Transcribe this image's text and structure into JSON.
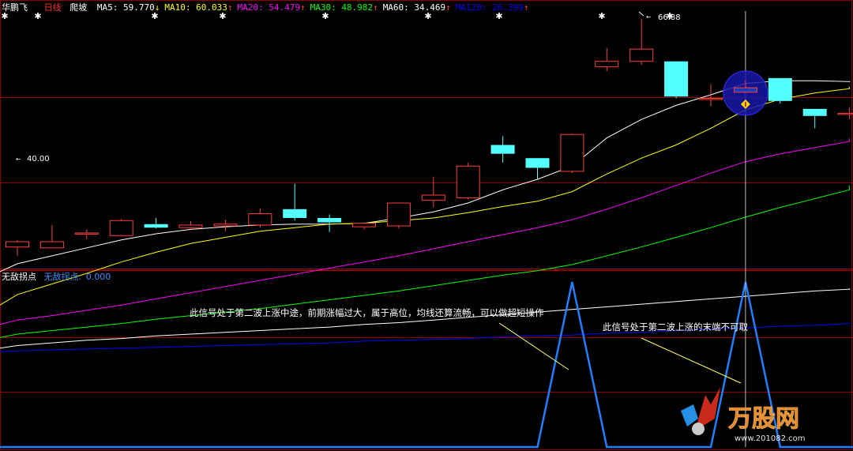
{
  "header": {
    "stock_name": "华鹏飞",
    "period": "日线",
    "pattern": "爬坡",
    "ma": [
      {
        "label": "MA5:",
        "value": "59.770",
        "arrow": "↓",
        "color": "#ffffff"
      },
      {
        "label": "MA10:",
        "value": "60.033",
        "arrow": "↑",
        "color": "#ffff00"
      },
      {
        "label": "MA20:",
        "value": "54.479",
        "arrow": "↑",
        "color": "#ff00ff"
      },
      {
        "label": "MA30:",
        "value": "48.982",
        "arrow": "↑",
        "color": "#00ff00"
      },
      {
        "label": "MA60:",
        "value": "34.469",
        "arrow": "↑",
        "color": "#ffffff"
      },
      {
        "label": "MA120:",
        "value": "26.399",
        "arrow": "↑",
        "color": "#0000ff"
      }
    ]
  },
  "indicator_header": {
    "name": "无敌拐点",
    "series_label": "无敌拐点:",
    "series_value": "0.000"
  },
  "annotations": {
    "high_price": "66.88",
    "low_price": "40.00",
    "note1": "此信号处于第二波上涨中途，前期涨幅过大，属于高位，均线还算流畅，可以做超短操作",
    "note2": "此信号处于第二波上涨的末端不可取"
  },
  "watermark": {
    "brand": "万股网",
    "url": "www.201082.com"
  },
  "colors": {
    "up": "#ff3d3d",
    "down": "#54ffff",
    "grid": "#8b0000",
    "signal": "#1e7fff",
    "name": "#ff3030"
  },
  "chart_data": {
    "type": "candlestick",
    "ylim": [
      39,
      68
    ],
    "candles": [
      {
        "o": 41.0,
        "h": 41.8,
        "l": 40.0,
        "c": 41.6
      },
      {
        "o": 40.9,
        "h": 43.5,
        "l": 40.9,
        "c": 41.6
      },
      {
        "o": 42.6,
        "h": 43.0,
        "l": 41.9,
        "c": 42.6
      },
      {
        "o": 42.3,
        "h": 44.2,
        "l": 42.2,
        "c": 44.0
      },
      {
        "o": 43.6,
        "h": 44.3,
        "l": 43.1,
        "c": 43.2
      },
      {
        "o": 43.2,
        "h": 43.9,
        "l": 43.0,
        "c": 43.5
      },
      {
        "o": 43.4,
        "h": 44.1,
        "l": 42.8,
        "c": 43.6
      },
      {
        "o": 43.5,
        "h": 45.4,
        "l": 43.2,
        "c": 44.8
      },
      {
        "o": 45.3,
        "h": 48.2,
        "l": 44.0,
        "c": 44.3
      },
      {
        "o": 44.3,
        "h": 44.7,
        "l": 42.7,
        "c": 43.8
      },
      {
        "o": 43.3,
        "h": 43.8,
        "l": 43.0,
        "c": 43.7
      },
      {
        "o": 43.4,
        "h": 46.0,
        "l": 43.1,
        "c": 46.0
      },
      {
        "o": 46.3,
        "h": 49.0,
        "l": 45.5,
        "c": 46.9
      },
      {
        "o": 46.6,
        "h": 50.6,
        "l": 46.4,
        "c": 50.2
      },
      {
        "o": 52.6,
        "h": 53.6,
        "l": 50.6,
        "c": 51.6
      },
      {
        "o": 51.1,
        "h": 51.1,
        "l": 48.7,
        "c": 50.0
      },
      {
        "o": 49.6,
        "h": 53.9,
        "l": 49.4,
        "c": 53.8
      },
      {
        "o": 61.5,
        "h": 63.6,
        "l": 61.0,
        "c": 62.1
      },
      {
        "o": 62.1,
        "h": 66.9,
        "l": 61.7,
        "c": 63.5
      },
      {
        "o": 62.1,
        "h": 62.1,
        "l": 57.9,
        "c": 58.1
      },
      {
        "o": 57.9,
        "h": 59.5,
        "l": 57.0,
        "c": 57.9
      },
      {
        "o": 59.1,
        "h": 59.9,
        "l": 56.5,
        "c": 58.6
      },
      {
        "o": 60.2,
        "h": 60.2,
        "l": 57.3,
        "c": 57.6
      },
      {
        "o": 56.7,
        "h": 56.7,
        "l": 54.5,
        "c": 55.9
      },
      {
        "o": 56.2,
        "h": 56.9,
        "l": 55.5,
        "c": 56.2
      }
    ],
    "ma_series": [
      {
        "name": "MA5",
        "color": "#ffffff",
        "values": [
          [
            0,
            39.1
          ],
          [
            1,
            40.0
          ],
          [
            2,
            40.9
          ],
          [
            3,
            41.8
          ],
          [
            4,
            42.5
          ],
          [
            5,
            43.0
          ],
          [
            6,
            43.3
          ],
          [
            7,
            43.5
          ],
          [
            8,
            43.6
          ],
          [
            9,
            43.6
          ],
          [
            10,
            43.7
          ],
          [
            11,
            44.3
          ],
          [
            12,
            45.0
          ],
          [
            13,
            46.0
          ],
          [
            14,
            47.5
          ],
          [
            15,
            48.7
          ],
          [
            16,
            50.2
          ],
          [
            17,
            53.4
          ],
          [
            18,
            55.5
          ],
          [
            19,
            57.1
          ],
          [
            20,
            58.3
          ],
          [
            21,
            59.6
          ],
          [
            22,
            59.9
          ],
          [
            23,
            59.9
          ],
          [
            24,
            59.8
          ]
        ]
      },
      {
        "name": "MA10",
        "color": "#ffff00",
        "values": [
          [
            0,
            35.6
          ],
          [
            1,
            36.8
          ],
          [
            2,
            38.0
          ],
          [
            3,
            39.3
          ],
          [
            4,
            40.4
          ],
          [
            5,
            41.4
          ],
          [
            6,
            42.1
          ],
          [
            7,
            42.8
          ],
          [
            8,
            43.2
          ],
          [
            9,
            43.6
          ],
          [
            10,
            43.7
          ],
          [
            11,
            44.0
          ],
          [
            12,
            44.3
          ],
          [
            13,
            44.9
          ],
          [
            14,
            45.6
          ],
          [
            15,
            46.2
          ],
          [
            16,
            47.3
          ],
          [
            17,
            49.3
          ],
          [
            18,
            51.1
          ],
          [
            19,
            52.6
          ],
          [
            20,
            54.5
          ],
          [
            21,
            56.6
          ],
          [
            22,
            57.8
          ],
          [
            23,
            58.5
          ],
          [
            24,
            59.0
          ]
        ]
      },
      {
        "name": "MA20",
        "color": "#ff00ff",
        "values": [
          [
            0,
            32.7
          ],
          [
            1,
            33.2
          ],
          [
            2,
            33.8
          ],
          [
            3,
            34.4
          ],
          [
            4,
            35.1
          ],
          [
            5,
            35.8
          ],
          [
            6,
            36.5
          ],
          [
            7,
            37.2
          ],
          [
            8,
            37.9
          ],
          [
            9,
            38.6
          ],
          [
            10,
            39.3
          ],
          [
            11,
            40.0
          ],
          [
            12,
            40.8
          ],
          [
            13,
            41.6
          ],
          [
            14,
            42.4
          ],
          [
            15,
            43.2
          ],
          [
            16,
            44.1
          ],
          [
            17,
            45.3
          ],
          [
            18,
            46.6
          ],
          [
            19,
            48.0
          ],
          [
            20,
            49.4
          ],
          [
            21,
            50.7
          ],
          [
            22,
            51.6
          ],
          [
            23,
            52.3
          ],
          [
            24,
            53.0
          ]
        ]
      },
      {
        "name": "MA30",
        "color": "#00ff00",
        "values": [
          [
            0,
            31.1
          ],
          [
            1,
            31.5
          ],
          [
            2,
            31.9
          ],
          [
            3,
            32.3
          ],
          [
            4,
            32.8
          ],
          [
            5,
            33.2
          ],
          [
            6,
            33.6
          ],
          [
            7,
            34.0
          ],
          [
            8,
            34.5
          ],
          [
            9,
            35.0
          ],
          [
            10,
            35.5
          ],
          [
            11,
            36.0
          ],
          [
            12,
            36.6
          ],
          [
            13,
            37.2
          ],
          [
            14,
            37.8
          ],
          [
            15,
            38.3
          ],
          [
            16,
            39.0
          ],
          [
            17,
            40.0
          ],
          [
            18,
            41.0
          ],
          [
            19,
            42.1
          ],
          [
            20,
            43.2
          ],
          [
            21,
            44.4
          ],
          [
            22,
            45.5
          ],
          [
            23,
            46.5
          ],
          [
            24,
            47.5
          ]
        ]
      },
      {
        "name": "MA60",
        "color": "#ffffff",
        "values": [
          [
            0,
            29.8
          ],
          [
            1,
            30.1
          ],
          [
            2,
            30.4
          ],
          [
            3,
            30.6
          ],
          [
            4,
            30.9
          ],
          [
            5,
            31.1
          ],
          [
            6,
            31.3
          ],
          [
            7,
            31.5
          ],
          [
            8,
            31.7
          ],
          [
            9,
            31.9
          ],
          [
            10,
            32.2
          ],
          [
            11,
            32.4
          ],
          [
            12,
            32.7
          ],
          [
            13,
            33.0
          ],
          [
            14,
            33.3
          ],
          [
            15,
            33.6
          ],
          [
            16,
            33.9
          ],
          [
            17,
            34.2
          ],
          [
            18,
            34.5
          ],
          [
            19,
            34.8
          ],
          [
            20,
            35.1
          ],
          [
            21,
            35.4
          ],
          [
            22,
            35.7
          ],
          [
            23,
            36.0
          ],
          [
            24,
            36.2
          ]
        ]
      },
      {
        "name": "MA120",
        "color": "#0000ff",
        "values": [
          [
            0,
            29.2
          ],
          [
            1,
            29.3
          ],
          [
            2,
            29.4
          ],
          [
            3,
            29.5
          ],
          [
            4,
            29.6
          ],
          [
            5,
            29.7
          ],
          [
            6,
            29.8
          ],
          [
            7,
            29.9
          ],
          [
            8,
            30.0
          ],
          [
            9,
            30.1
          ],
          [
            10,
            30.3
          ],
          [
            11,
            30.4
          ],
          [
            12,
            30.5
          ],
          [
            13,
            30.6
          ],
          [
            14,
            30.8
          ],
          [
            15,
            30.9
          ],
          [
            16,
            31.0
          ],
          [
            17,
            31.2
          ],
          [
            18,
            31.3
          ],
          [
            19,
            31.5
          ],
          [
            20,
            31.7
          ],
          [
            21,
            31.8
          ],
          [
            22,
            32.0
          ],
          [
            23,
            32.1
          ],
          [
            24,
            32.3
          ]
        ]
      }
    ],
    "signal": {
      "name": "无敌拐点",
      "values": [
        0,
        0,
        0,
        0,
        0,
        0,
        0,
        0,
        0,
        0,
        0,
        0,
        0,
        0,
        0,
        0,
        1,
        0,
        0,
        0,
        0,
        1,
        0,
        0,
        0
      ]
    },
    "signal_ylim": [
      0,
      1
    ],
    "highlight_index": 21
  }
}
